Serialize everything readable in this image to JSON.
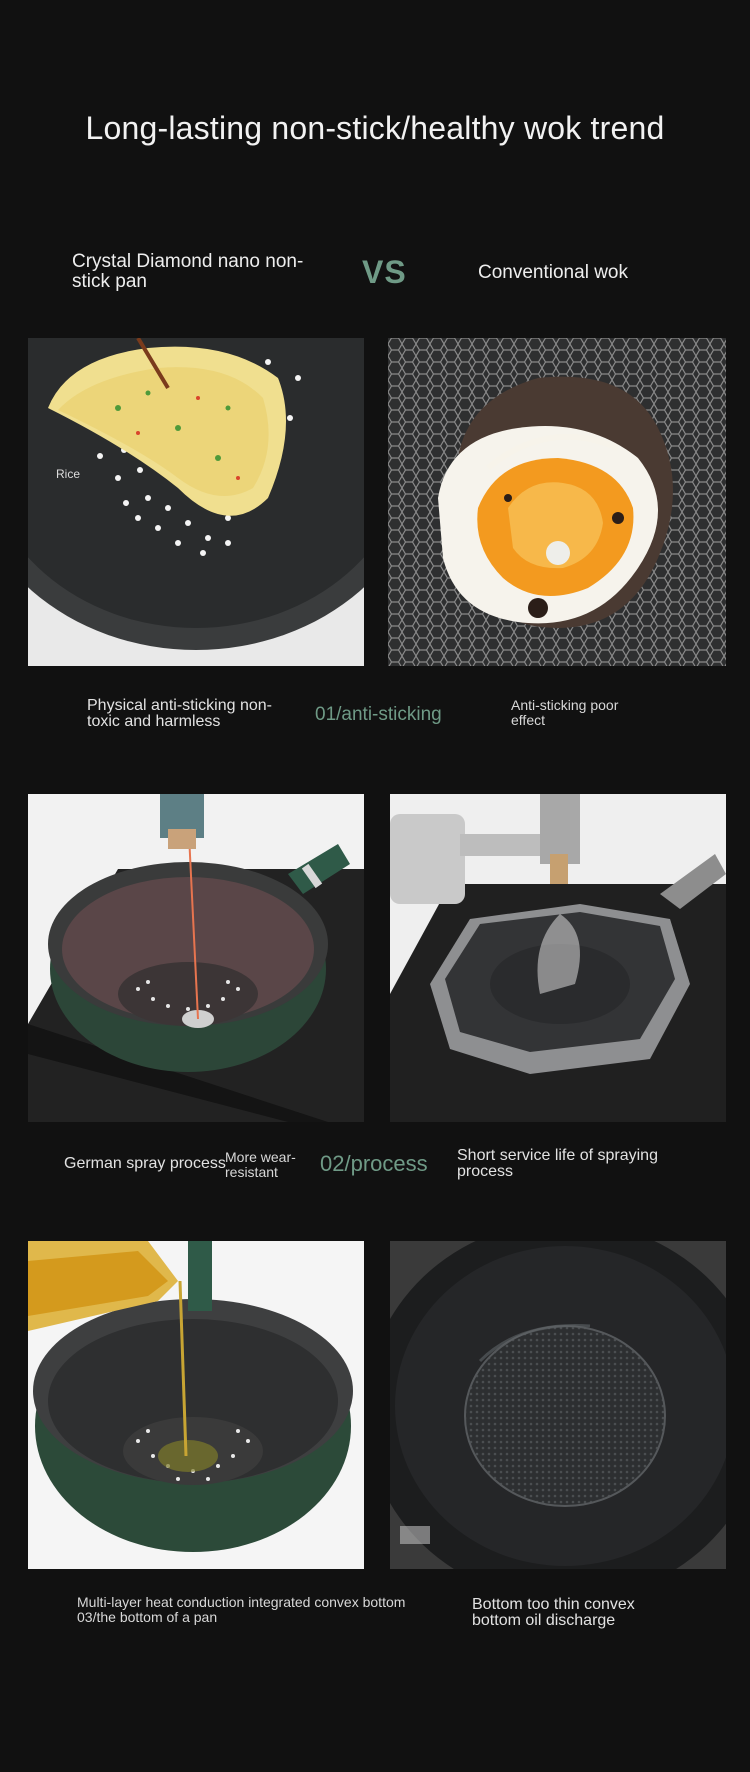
{
  "header": {
    "title": "Long-lasting non-stick/healthy wok trend"
  },
  "comparison": {
    "left_label": "Crystal Diamond nano non-stick pan",
    "vs_label": "VS",
    "right_label": "Conventional wok"
  },
  "section1": {
    "image_label": "Rice",
    "left_caption": "Physical anti-sticking non-toxic and harmless",
    "center_label": "01/anti-sticking",
    "right_caption": "Anti-sticking poor effect"
  },
  "section2": {
    "left_caption": "German spray process",
    "left_caption_2": "More wear-resistant",
    "center_label": "02/process",
    "right_caption": "Short service life of spraying process"
  },
  "section3": {
    "left_caption_line1": "Multi-layer heat conduction integrated convex bottom",
    "left_caption_line2": "03/the bottom of a pan",
    "right_caption": "Bottom too thin convex bottom oil discharge"
  },
  "colors": {
    "background": "#111111",
    "accent": "#6f9a86",
    "text": "#e8e8e8"
  }
}
